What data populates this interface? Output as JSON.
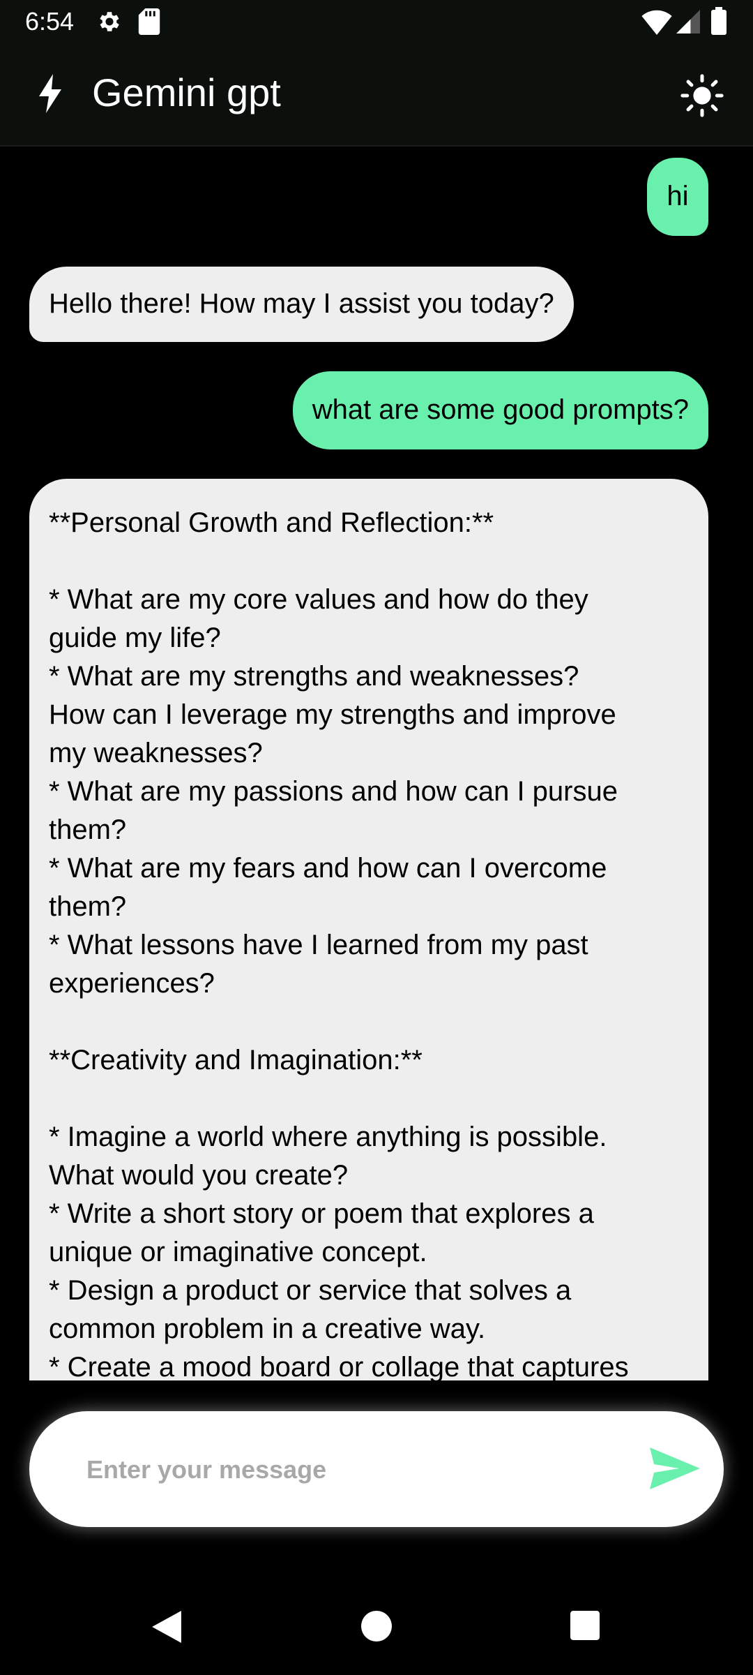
{
  "status_bar": {
    "time": "6:54",
    "icons": [
      "gear-icon",
      "sd-card-icon",
      "wifi-icon",
      "signal-icon",
      "battery-icon"
    ]
  },
  "app_bar": {
    "title": "Gemini gpt",
    "icons": [
      "bolt-icon",
      "sun-theme-icon"
    ]
  },
  "messages": [
    {
      "role": "user",
      "text": "hi"
    },
    {
      "role": "bot",
      "text": "Hello there! How may I assist you today?"
    },
    {
      "role": "user",
      "text": "what are some good prompts?"
    },
    {
      "role": "bot",
      "text": "**Personal Growth and Reflection:**\n\n* What are my core values and how do they\nguide my life?\n* What are my strengths and weaknesses?\nHow can I leverage my strengths and improve\nmy weaknesses?\n* What are my passions and how can I pursue\nthem?\n* What are my fears and how can I overcome\nthem?\n* What lessons have I learned from my past\nexperiences?\n\n**Creativity and Imagination:**\n\n* Imagine a world where anything is possible.\nWhat would you create?\n* Write a short story or poem that explores a\nunique or imaginative concept.\n* Design a product or service that solves a\ncommon problem in a creative way.\n* Create a mood board or collage that captures"
    }
  ],
  "input": {
    "placeholder": "Enter your message",
    "value": ""
  },
  "colors": {
    "accent": "#6af0ad",
    "bot_bubble": "#eeeeee",
    "app_bar": "#0b100d",
    "background": "#000000"
  },
  "nav_bar": {
    "icons": [
      "back-icon",
      "home-icon",
      "recents-icon"
    ]
  }
}
